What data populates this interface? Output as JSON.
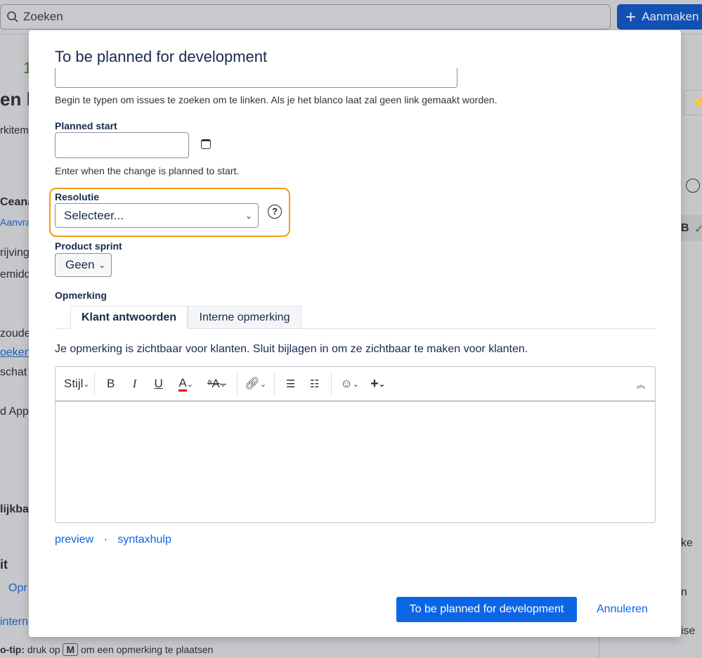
{
  "topbar": {
    "search_placeholder": "Zoeken",
    "create_label": "Aanmaken"
  },
  "background": {
    "left": [
      "1",
      "en k",
      "rkitem",
      "Ceana",
      "Aanvra",
      "rijving",
      "emidd",
      "zoude",
      "oeken",
      "schat",
      "d Appl",
      "lijkba",
      "it",
      "Opr",
      "intern"
    ],
    "tip": {
      "prefix": "o-tip:",
      "text1": "druk op",
      "key": "M",
      "text2": "om een opmerking te plaatsen"
    },
    "right": [
      "B",
      "ke",
      "n",
      "ise"
    ]
  },
  "modal": {
    "title": "To be planned for development",
    "link_help": "Begin te typen om issues te zoeken om te linken. Als je het blanco laat zal geen link gemaakt worden.",
    "planned_start": {
      "label": "Planned start",
      "value": "",
      "help": "Enter when the change is planned to start."
    },
    "resolutie": {
      "label": "Resolutie",
      "value": "Selecteer..."
    },
    "product_sprint": {
      "label": "Product sprint",
      "value": "Geen"
    },
    "opmerking": {
      "label": "Opmerking",
      "tabs": [
        {
          "label": "Klant antwoorden",
          "active": true
        },
        {
          "label": "Interne opmerking",
          "active": false
        }
      ],
      "visibility_note": "Je opmerking is zichtbaar voor klanten. Sluit bijlagen in om ze zichtbaar te maken voor klanten.",
      "toolbar": {
        "style": "Stijl",
        "bold": "B",
        "italic": "I",
        "underline": "U",
        "color": "A",
        "format": "ᵃA",
        "expand": "︽"
      },
      "value": "",
      "preview": "preview",
      "dot": "·",
      "syntax_help": "syntaxhulp"
    },
    "submit_label": "To be planned for development",
    "cancel_label": "Annuleren"
  },
  "colors": {
    "accent": "#0c66e4",
    "highlight": "#f59a0a"
  }
}
